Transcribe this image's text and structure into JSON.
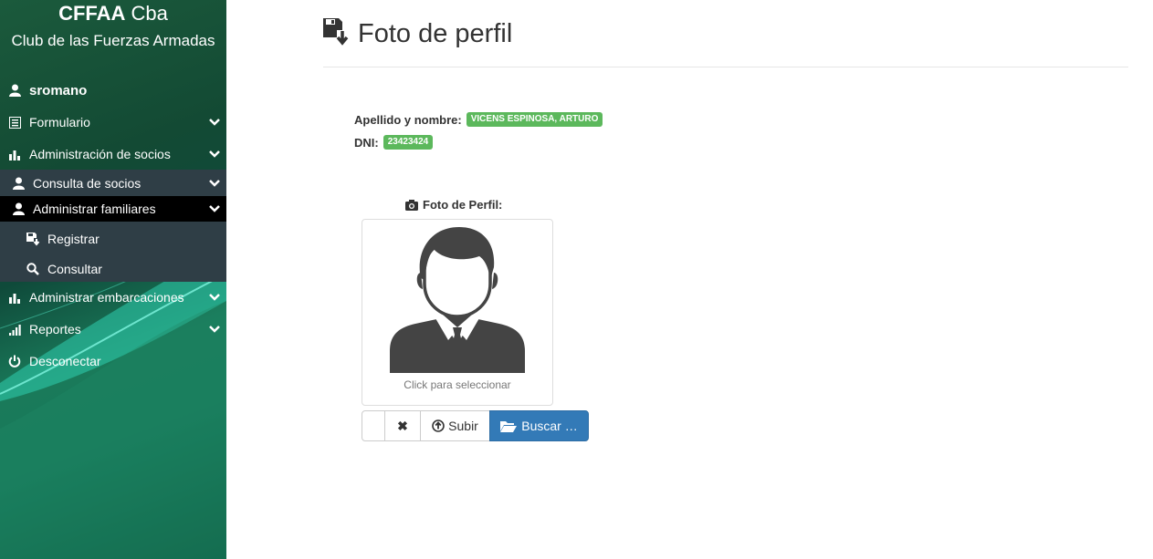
{
  "brand": {
    "title_bold": "CFFAA",
    "title_rest": " Cba",
    "subtitle": "Club de las Fuerzas Armadas"
  },
  "sidebar": {
    "user": "sromano",
    "items": [
      {
        "label": "Formulario",
        "icon": "list-icon"
      },
      {
        "label": "Administración de socios",
        "icon": "bar-chart-icon"
      },
      {
        "label": "Consulta de socios",
        "icon": "user-icon"
      },
      {
        "label": "Administrar familiares",
        "icon": "user-icon"
      },
      {
        "label": "Registrar",
        "icon": "save-icon"
      },
      {
        "label": "Consultar",
        "icon": "search-icon"
      },
      {
        "label": "Administrar embarcaciones",
        "icon": "bar-chart-icon"
      },
      {
        "label": "Reportes",
        "icon": "signal-icon"
      },
      {
        "label": "Desconectar",
        "icon": "power-icon"
      }
    ]
  },
  "page": {
    "title": "Foto de perfil"
  },
  "info": {
    "name_label": "Apellido y nombre:",
    "name_value": "VICENS ESPINOSA, ARTURO",
    "dni_label": "DNI:",
    "dni_value": "23423424"
  },
  "photo": {
    "label": "Foto de Perfil:",
    "caption": "Click para seleccionar"
  },
  "buttons": {
    "remove": "✖",
    "upload": "Subir",
    "browse": "Buscar …"
  },
  "colors": {
    "badge": "#5cb85c",
    "primary": "#337ab7",
    "sidebar_active": "#000000",
    "sidebar_sub": "#2f3e46"
  }
}
